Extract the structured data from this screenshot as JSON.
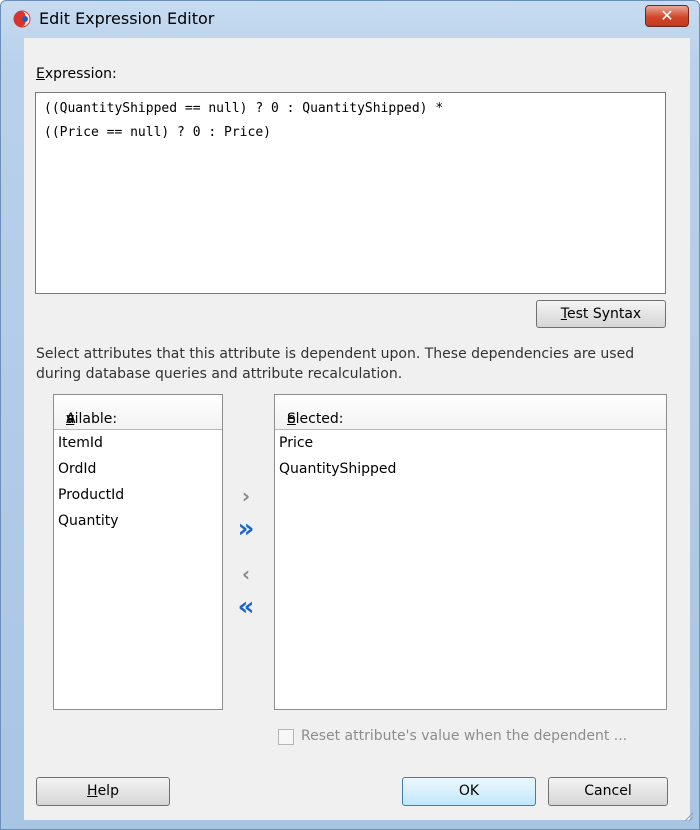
{
  "window": {
    "title": "Edit Expression Editor"
  },
  "expression": {
    "label_mnemonic": "E",
    "label_rest": "xpression:",
    "lines": [
      "((QuantityShipped == null) ? 0 : QuantityShipped) *",
      "((Price == null) ? 0 : Price)"
    ]
  },
  "test_syntax": {
    "mnemonic": "T",
    "rest": "est Syntax"
  },
  "description": "Select attributes that this attribute is dependent upon. These dependencies are used during database queries and attribute recalculation.",
  "available": {
    "header_prefix": "A",
    "header_mnemonic": "v",
    "header_rest": "ailable:",
    "items": [
      "ItemId",
      "OrdId",
      "ProductId",
      "Quantity"
    ]
  },
  "selected": {
    "header_mnemonic": "S",
    "header_rest": "elected:",
    "items": [
      "Price",
      "QuantityShipped"
    ]
  },
  "shuttle": {
    "move_right": "›",
    "move_all_right": "»",
    "move_left": "‹",
    "move_all_left": "«"
  },
  "reset_checkbox": {
    "label": "Reset attribute's value when the dependent ...",
    "checked": false,
    "enabled": false
  },
  "buttons": {
    "help_mnemonic": "H",
    "help_rest": "elp",
    "ok": "OK",
    "cancel": "Cancel"
  },
  "colors": {
    "accent_arrow": "#1c66c9",
    "disabled_arrow": "#8a8a8a",
    "close_red": "#c7432a"
  }
}
